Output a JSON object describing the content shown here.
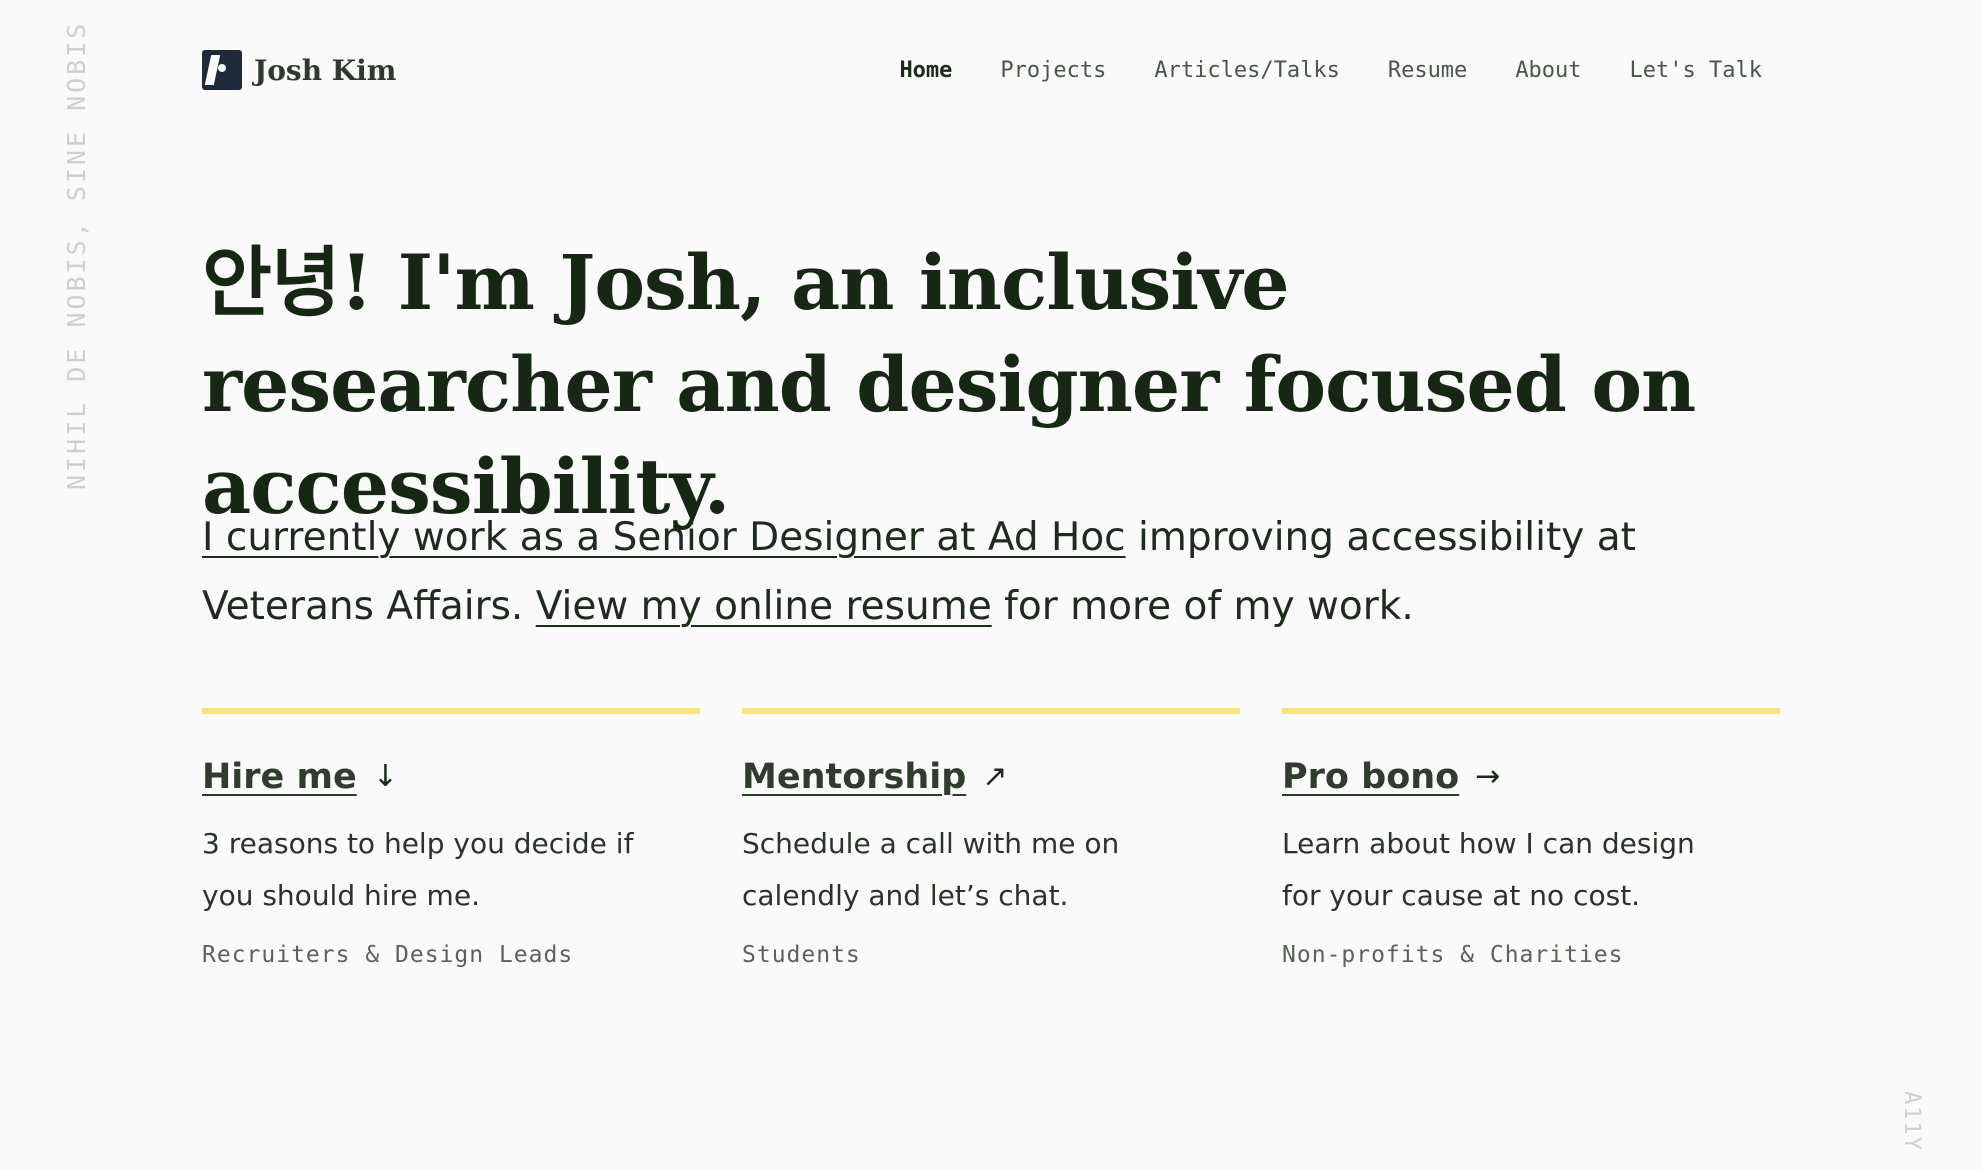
{
  "side_text": {
    "left": "NIHIL DE NOBIS, SINE NOBIS",
    "right": "A11Y"
  },
  "header": {
    "brand": "Josh Kim",
    "logo_icon": "jk-logo-icon",
    "nav": [
      {
        "label": "Home",
        "active": true
      },
      {
        "label": "Projects",
        "active": false
      },
      {
        "label": "Articles/Talks",
        "active": false
      },
      {
        "label": "Resume",
        "active": false
      },
      {
        "label": "About",
        "active": false
      },
      {
        "label": "Let's Talk",
        "active": false
      }
    ]
  },
  "hero": {
    "heading": "안녕! I'm Josh, an inclusive researcher and designer focused on accessibility."
  },
  "intro": {
    "link1": "I currently work as a Senior Designer at Ad Hoc",
    "text1": " improving accessibility at Veterans Affairs. ",
    "link2": "View my online resume",
    "text2": " for more of my work."
  },
  "cards": [
    {
      "title": "Hire me",
      "arrow": "↓",
      "arrow_icon": "arrow-down-icon",
      "description": "3 reasons to help you decide if you should hire me.",
      "audience": "Recruiters & Design Leads"
    },
    {
      "title": "Mentorship",
      "arrow": "↗",
      "arrow_icon": "arrow-up-right-icon",
      "description": "Schedule a call with me on calendly and let’s chat.",
      "audience": "Students"
    },
    {
      "title": "Pro bono",
      "arrow": "→",
      "arrow_icon": "arrow-right-icon",
      "description": "Learn about how I can design for your cause at no cost.",
      "audience": "Non-profits & Charities"
    }
  ],
  "colors": {
    "background": "#fafafa",
    "accent_rule": "#f8e47a",
    "heading": "#162814",
    "logo": "#1f2a3a"
  }
}
